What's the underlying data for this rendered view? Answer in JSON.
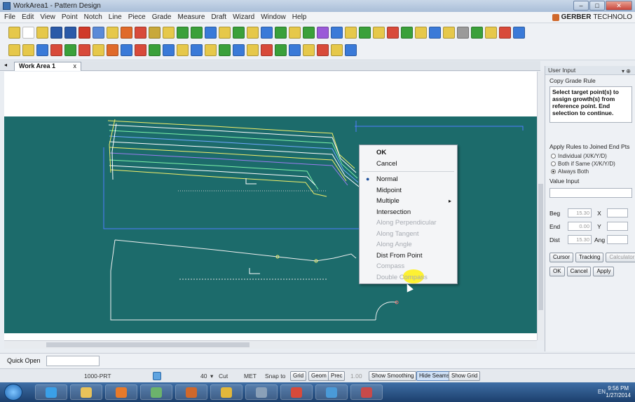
{
  "window": {
    "title": "WorkArea1 - Pattern Design"
  },
  "menu": [
    "File",
    "Edit",
    "View",
    "Point",
    "Notch",
    "Line",
    "Piece",
    "Grade",
    "Measure",
    "Draft",
    "Wizard",
    "Window",
    "Help"
  ],
  "brand": {
    "name": "GERBER",
    "suffix": "TECHNOLO"
  },
  "tabs": [
    {
      "label": "Work Area 1",
      "close": "x"
    }
  ],
  "context_menu": {
    "items": [
      {
        "label": "OK",
        "bold": true
      },
      {
        "label": "Cancel"
      },
      {
        "sep": true
      },
      {
        "label": "Normal",
        "checked": true
      },
      {
        "label": "Midpoint"
      },
      {
        "label": "Multiple",
        "submenu": true
      },
      {
        "label": "Intersection"
      },
      {
        "label": "Along Perpendicular",
        "disabled": true
      },
      {
        "label": "Along Tangent",
        "disabled": true
      },
      {
        "label": "Along Angle",
        "disabled": true
      },
      {
        "label": "Dist From Point"
      },
      {
        "label": "Compass",
        "disabled": true
      },
      {
        "label": "Double Compass",
        "disabled": true
      }
    ]
  },
  "user_input": {
    "header": "User Input",
    "function_name": "Copy Grade Rule",
    "instruction": "Select target point(s) to assign growth(s) from reference point. End selection to continue.",
    "apply_title": "Apply Rules to Joined End Pts",
    "options": [
      {
        "label": "Individual (X/K/Y/D)",
        "selected": false
      },
      {
        "label": "Both if Same (X/K/Y/D)",
        "selected": false
      },
      {
        "label": "Always Both",
        "selected": true
      }
    ],
    "value_input_label": "Value Input",
    "fields": [
      {
        "label": "Beg",
        "value": "15.30",
        "label2": "X"
      },
      {
        "label": "End",
        "value": "0.00",
        "label2": "Y"
      },
      {
        "label": "Dist",
        "value": "15.30",
        "label2": "Ang"
      }
    ],
    "buttons_row1": [
      "Cursor",
      "Tracking",
      "Calculator"
    ],
    "buttons_row2": [
      "OK",
      "Cancel",
      "Apply"
    ]
  },
  "quick_open": {
    "label": "Quick Open"
  },
  "status": {
    "piece": "1000-PRT",
    "zoom": "40",
    "unit_mode": "Cut",
    "measure": "MET",
    "snap_label": "Snap to",
    "snap_buttons": [
      "Grid",
      "Geom",
      "Prec"
    ],
    "prec_value": "1.00",
    "toggles": [
      {
        "label": "Show Smoothing",
        "active": false
      },
      {
        "label": "Hide Seams",
        "active": true
      },
      {
        "label": "Show Grid",
        "active": false
      }
    ]
  },
  "taskbar": {
    "tray_lang": "EN",
    "time": "9:56 PM",
    "date": "1/27/2014"
  }
}
